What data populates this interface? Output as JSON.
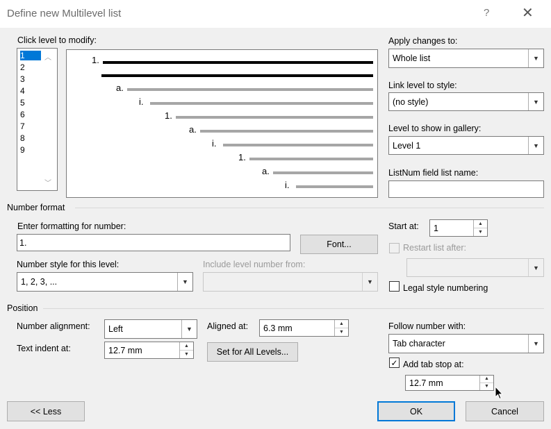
{
  "window": {
    "title": "Define new Multilevel list",
    "help": "?",
    "close": "✕"
  },
  "levels": {
    "label": "Click level to modify:",
    "items": [
      "1",
      "2",
      "3",
      "4",
      "5",
      "6",
      "7",
      "8",
      "9"
    ],
    "selected": "1"
  },
  "preview": {
    "numbers": [
      "1.",
      "a.",
      "i.",
      "1.",
      "a.",
      "i.",
      "1.",
      "a.",
      "i."
    ]
  },
  "apply_changes": {
    "label": "Apply changes to:",
    "value": "Whole list"
  },
  "link_level": {
    "label": "Link level to style:",
    "value": "(no style)"
  },
  "gallery_level": {
    "label": "Level to show in gallery:",
    "value": "Level 1"
  },
  "listnum": {
    "label": "ListNum field list name:",
    "value": ""
  },
  "number_format": {
    "section": "Number format",
    "enter_label": "Enter formatting for number:",
    "format_value": "1.",
    "font_button": "Font...",
    "style_label": "Number style for this level:",
    "style_value": "1, 2, 3, ...",
    "include_label": "Include level number from:",
    "include_value": "",
    "start_label": "Start at:",
    "start_value": "1",
    "restart_label": "Restart list after:",
    "restart_value": "",
    "legal_label": "Legal style numbering",
    "legal_checked": false
  },
  "position": {
    "section": "Position",
    "alignment_label": "Number alignment:",
    "alignment_value": "Left",
    "aligned_at_label": "Aligned at:",
    "aligned_at_value": "6.3 mm",
    "indent_label": "Text indent at:",
    "indent_value": "12.7 mm",
    "set_all_button": "Set for All Levels...",
    "follow_label": "Follow number with:",
    "follow_value": "Tab character",
    "tab_stop_label": "Add tab stop at:",
    "tab_stop_checked": true,
    "tab_stop_value": "12.7 mm"
  },
  "buttons": {
    "less": "<< Less",
    "ok": "OK",
    "cancel": "Cancel"
  }
}
